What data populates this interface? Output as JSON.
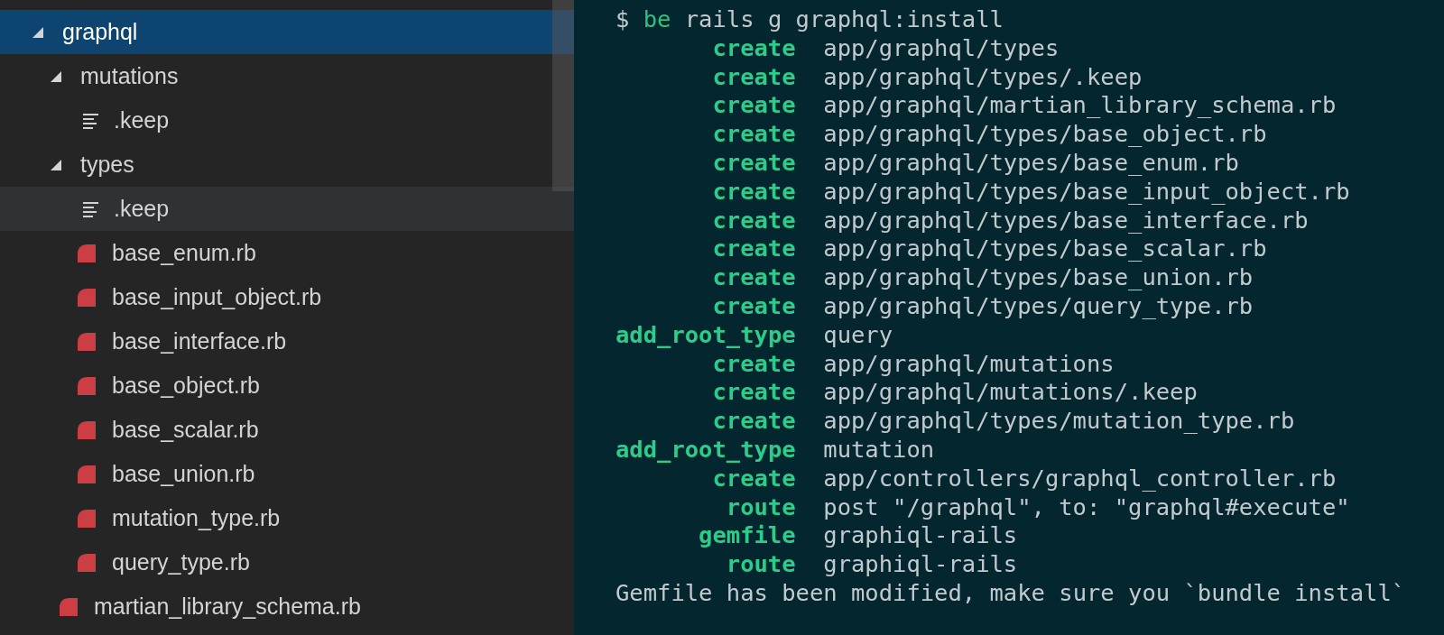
{
  "explorer": {
    "tree": [
      {
        "name": "graphql",
        "kind": "folder",
        "expanded": true,
        "selected": true,
        "hovered": false,
        "children": [
          {
            "name": "mutations",
            "kind": "folder",
            "expanded": true,
            "selected": false,
            "hovered": false,
            "children": [
              {
                "name": ".keep",
                "kind": "text",
                "selected": false,
                "hovered": false
              }
            ]
          },
          {
            "name": "types",
            "kind": "folder",
            "expanded": true,
            "selected": false,
            "hovered": false,
            "children": [
              {
                "name": ".keep",
                "kind": "text",
                "selected": false,
                "hovered": true
              },
              {
                "name": "base_enum.rb",
                "kind": "ruby",
                "selected": false,
                "hovered": false
              },
              {
                "name": "base_input_object.rb",
                "kind": "ruby",
                "selected": false,
                "hovered": false
              },
              {
                "name": "base_interface.rb",
                "kind": "ruby",
                "selected": false,
                "hovered": false
              },
              {
                "name": "base_object.rb",
                "kind": "ruby",
                "selected": false,
                "hovered": false
              },
              {
                "name": "base_scalar.rb",
                "kind": "ruby",
                "selected": false,
                "hovered": false
              },
              {
                "name": "base_union.rb",
                "kind": "ruby",
                "selected": false,
                "hovered": false
              },
              {
                "name": "mutation_type.rb",
                "kind": "ruby",
                "selected": false,
                "hovered": false
              },
              {
                "name": "query_type.rb",
                "kind": "ruby",
                "selected": false,
                "hovered": false
              }
            ]
          },
          {
            "name": "martian_library_schema.rb",
            "kind": "ruby",
            "selected": false,
            "hovered": false
          }
        ]
      }
    ]
  },
  "terminal": {
    "lines": [
      {
        "kind": "prompt",
        "prompt": "$",
        "command": "be",
        "args": "rails g graphql:install"
      },
      {
        "kind": "action",
        "action": "create",
        "text": "app/graphql/types"
      },
      {
        "kind": "action",
        "action": "create",
        "text": "app/graphql/types/.keep"
      },
      {
        "kind": "action",
        "action": "create",
        "text": "app/graphql/martian_library_schema.rb"
      },
      {
        "kind": "action",
        "action": "create",
        "text": "app/graphql/types/base_object.rb"
      },
      {
        "kind": "action",
        "action": "create",
        "text": "app/graphql/types/base_enum.rb"
      },
      {
        "kind": "action",
        "action": "create",
        "text": "app/graphql/types/base_input_object.rb"
      },
      {
        "kind": "action",
        "action": "create",
        "text": "app/graphql/types/base_interface.rb"
      },
      {
        "kind": "action",
        "action": "create",
        "text": "app/graphql/types/base_scalar.rb"
      },
      {
        "kind": "action",
        "action": "create",
        "text": "app/graphql/types/base_union.rb"
      },
      {
        "kind": "action",
        "action": "create",
        "text": "app/graphql/types/query_type.rb"
      },
      {
        "kind": "action",
        "action": "add_root_type",
        "text": "query"
      },
      {
        "kind": "action",
        "action": "create",
        "text": "app/graphql/mutations"
      },
      {
        "kind": "action",
        "action": "create",
        "text": "app/graphql/mutations/.keep"
      },
      {
        "kind": "action",
        "action": "create",
        "text": "app/graphql/types/mutation_type.rb"
      },
      {
        "kind": "action",
        "action": "add_root_type",
        "text": "mutation"
      },
      {
        "kind": "action",
        "action": "create",
        "text": "app/controllers/graphql_controller.rb"
      },
      {
        "kind": "action",
        "action": "route",
        "text": "post \"/graphql\", to: \"graphql#execute\""
      },
      {
        "kind": "action",
        "action": "gemfile",
        "text": "graphiql-rails"
      },
      {
        "kind": "action",
        "action": "route",
        "text": "graphiql-rails"
      },
      {
        "kind": "output",
        "text": "Gemfile has been modified, make sure you `bundle install`"
      }
    ]
  }
}
